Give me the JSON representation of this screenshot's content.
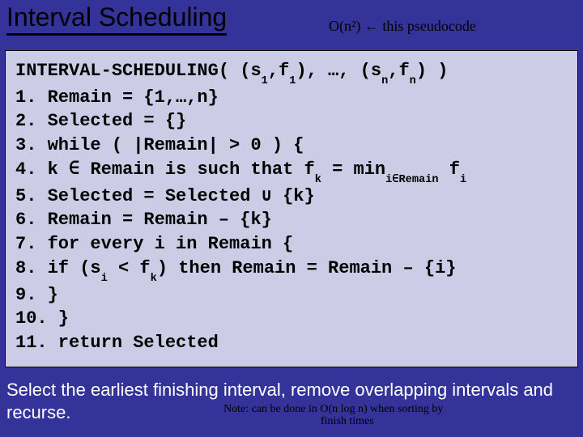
{
  "title": "Interval Scheduling",
  "hand_annotation_top": "O(n²) ← this pseudocode",
  "code": {
    "sig_prefix": "INTERVAL-SCHEDULING( (s",
    "sig_sub1a": "1",
    "sig_mid1": ",f",
    "sig_sub1b": "1",
    "sig_mid2": "), …, (s",
    "sig_subn_a": "n",
    "sig_mid3": ",f",
    "sig_subn_b": "n",
    "sig_suffix": ") )",
    "l1": "1. Remain = {1,…,n}",
    "l2": "2. Selected = {}",
    "l3": "3. while ( |Remain| > 0 ) {",
    "l4_prefix": "4.    k ∈ Remain is such that f",
    "l4_sub_k": "k",
    "l4_mid": " = min",
    "l4_sub_i": "i∈Remain",
    "l4_suffix": " f",
    "l4_sub_fi": "i",
    "l5": "5.    Selected = Selected ∪ {k}",
    "l6": "6.    Remain = Remain – {k}",
    "l7": "7.    for every i in Remain {",
    "l8_prefix": "8.       if (s",
    "l8_sub_i": "i",
    "l8_mid": " < f",
    "l8_sub_k": "k",
    "l8_suffix": ") then Remain = Remain – {i}",
    "l9": "9.    }",
    "l10": "10. }",
    "l11": "11. return Selected"
  },
  "caption": "Select the earliest finishing interval, remove overlapping intervals and recurse.",
  "hand_annotation_bottom_line1": "Note: can be done in O(n log n) when sorting by",
  "hand_annotation_bottom_line2": "finish times"
}
